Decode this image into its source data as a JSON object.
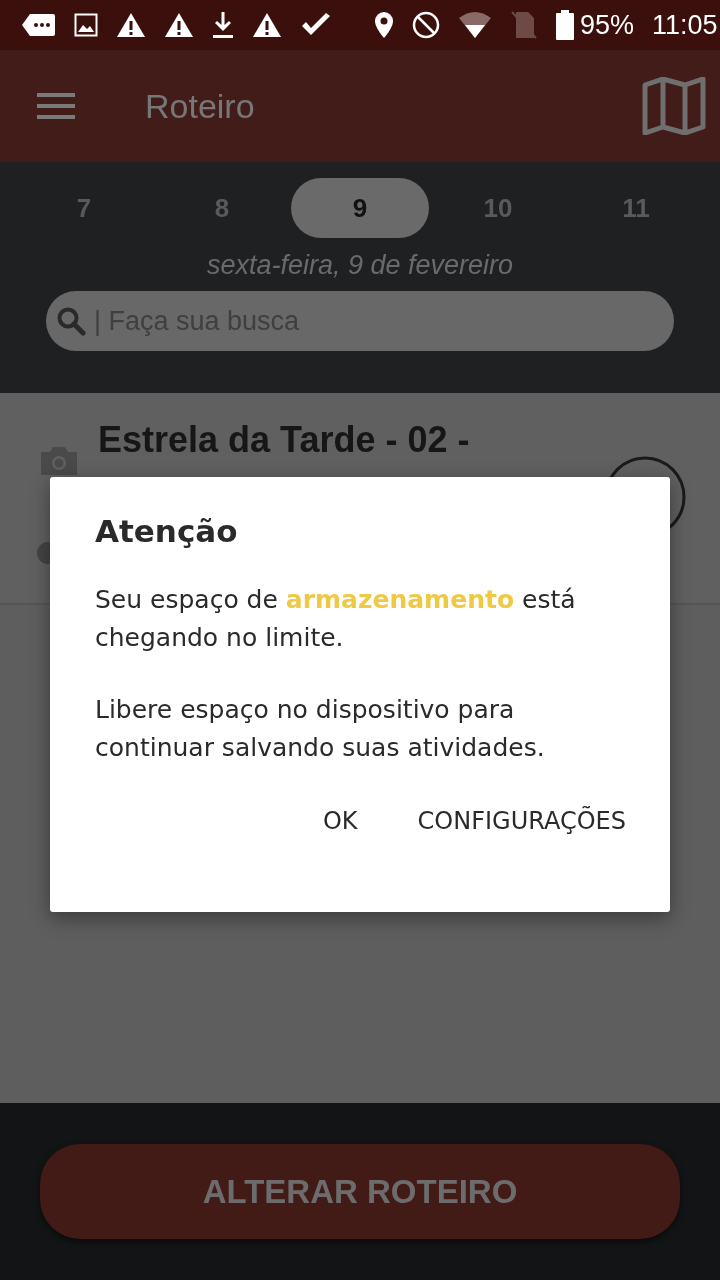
{
  "status_bar": {
    "battery": "95%",
    "time": "11:05"
  },
  "app_bar": {
    "title": "Roteiro"
  },
  "days": [
    {
      "label": "7",
      "selected": false
    },
    {
      "label": "8",
      "selected": false
    },
    {
      "label": "9",
      "selected": true
    },
    {
      "label": "10",
      "selected": false
    },
    {
      "label": "11",
      "selected": false
    }
  ],
  "date_label": "sexta-feira, 9 de fevereiro",
  "search": {
    "placeholder": "| Faça sua busca"
  },
  "card": {
    "title": "Estrela da Tarde - 02 -"
  },
  "dialog": {
    "title": "Atenção",
    "paragraphs": [
      "Seu espaço de **armazenamento** está chegando no limite.",
      "Libere espaço no dispositivo para continuar salvando suas atividades."
    ],
    "buttons": [
      "OK",
      "CONFIGURAÇÕES"
    ]
  },
  "bottom_button": {
    "label": "ALTERAR ROTEIRO"
  }
}
